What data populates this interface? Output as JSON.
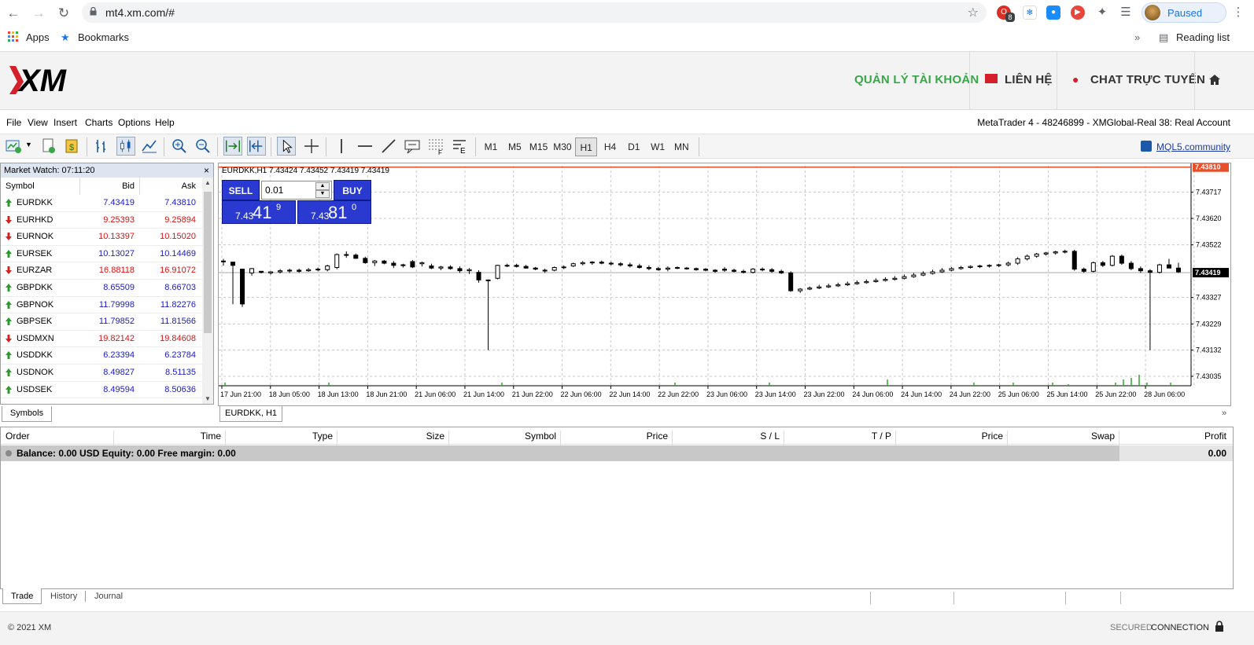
{
  "browser": {
    "url": "mt4.xm.com/#",
    "profile_status": "Paused",
    "bookmarks": {
      "apps": "Apps",
      "bookmarks": "Bookmarks",
      "reading_list": "Reading list"
    },
    "ext_badge": "8"
  },
  "xm_header": {
    "logo": "XM",
    "nav": {
      "account": "QUẢN LÝ TÀI KHOẢN",
      "contact": "LIÊN HỆ",
      "chat": "CHAT TRỰC TUYẾN"
    },
    "colors": {
      "account": "#3aa64a",
      "accent": "#d3202a"
    }
  },
  "menubar": {
    "items": [
      "File",
      "View",
      "Insert",
      "Charts",
      "Options",
      "Help"
    ],
    "account_info": "MetaTrader 4 - 48246899 - XMGlobal-Real 38: Real Account"
  },
  "toolbar": {
    "timeframes": [
      "M1",
      "M5",
      "M15",
      "M30",
      "H1",
      "H4",
      "D1",
      "W1",
      "MN"
    ],
    "active_timeframe": "H1",
    "mql5_link": "MQL5.community"
  },
  "market_watch": {
    "title": "Market Watch: 07:11:20",
    "columns": {
      "symbol": "Symbol",
      "bid": "Bid",
      "ask": "Ask"
    },
    "rows": [
      {
        "symbol": "EURDKK",
        "bid": "7.43419",
        "ask": "7.43810",
        "dir": "up",
        "color": "#1a1acc"
      },
      {
        "symbol": "EURHKD",
        "bid": "9.25393",
        "ask": "9.25894",
        "dir": "down",
        "color": "#e01010"
      },
      {
        "symbol": "EURNOK",
        "bid": "10.13397",
        "ask": "10.15020",
        "dir": "down",
        "color": "#e01010"
      },
      {
        "symbol": "EURSEK",
        "bid": "10.13027",
        "ask": "10.14469",
        "dir": "up",
        "color": "#1a1acc"
      },
      {
        "symbol": "EURZAR",
        "bid": "16.88118",
        "ask": "16.91072",
        "dir": "down",
        "color": "#e01010"
      },
      {
        "symbol": "GBPDKK",
        "bid": "8.65509",
        "ask": "8.66703",
        "dir": "up",
        "color": "#1a1acc"
      },
      {
        "symbol": "GBPNOK",
        "bid": "11.79998",
        "ask": "11.82276",
        "dir": "up",
        "color": "#1a1acc"
      },
      {
        "symbol": "GBPSEK",
        "bid": "11.79852",
        "ask": "11.81566",
        "dir": "up",
        "color": "#1a1acc"
      },
      {
        "symbol": "USDMXN",
        "bid": "19.82142",
        "ask": "19.84608",
        "dir": "down",
        "color": "#e01010"
      },
      {
        "symbol": "USDDKK",
        "bid": "6.23394",
        "ask": "6.23784",
        "dir": "up",
        "color": "#1a1acc"
      },
      {
        "symbol": "USDNOK",
        "bid": "8.49827",
        "ask": "8.51135",
        "dir": "up",
        "color": "#1a1acc"
      },
      {
        "symbol": "USDSEK",
        "bid": "8.49594",
        "ask": "8.50636",
        "dir": "up",
        "color": "#1a1acc"
      }
    ],
    "tab": "Symbols"
  },
  "chart": {
    "info": "EURDKK,H1  7.43424 7.43452 7.43419 7.43419",
    "tab": "EURDKK, H1",
    "sell_label": "SELL",
    "buy_label": "BUY",
    "lot": "0.01",
    "sell_price": {
      "prefix": "7.43",
      "big": "41",
      "sup": "9"
    },
    "buy_price": {
      "prefix": "7.43",
      "big": "81",
      "sup": "0"
    },
    "ask_tag": "7.43810",
    "bid_tag": "7.43419"
  },
  "chart_data": {
    "type": "candlestick",
    "symbol": "EURDKK",
    "timeframe": "H1",
    "y_ticks": [
      "7.43717",
      "7.43620",
      "7.43522",
      "7.43327",
      "7.43229",
      "7.43132",
      "7.43035"
    ],
    "ylim": [
      7.43,
      7.43815
    ],
    "x_ticks": [
      "17 Jun 21:00",
      "18 Jun 05:00",
      "18 Jun 13:00",
      "18 Jun 21:00",
      "21 Jun 06:00",
      "21 Jun 14:00",
      "21 Jun 22:00",
      "22 Jun 06:00",
      "22 Jun 14:00",
      "22 Jun 22:00",
      "23 Jun 06:00",
      "23 Jun 14:00",
      "23 Jun 22:00",
      "24 Jun 06:00",
      "24 Jun 14:00",
      "24 Jun 22:00",
      "25 Jun 06:00",
      "25 Jun 14:00",
      "25 Jun 22:00",
      "28 Jun 06:00"
    ],
    "ask": 7.4381,
    "bid": 7.43419,
    "candles": [
      [
        7.43462,
        7.4347,
        7.43445,
        7.4346
      ],
      [
        7.43458,
        7.43446,
        7.43302,
        7.43446
      ],
      [
        7.43432,
        7.43432,
        7.43292,
        7.43303
      ],
      [
        7.43418,
        7.43436,
        7.43408,
        7.43434
      ],
      [
        7.43424,
        7.43424,
        7.43416,
        7.4342
      ],
      [
        7.43418,
        7.43424,
        7.43412,
        7.43422
      ],
      [
        7.43422,
        7.43432,
        7.43416,
        7.43426
      ],
      [
        7.43426,
        7.43434,
        7.43418,
        7.43428
      ],
      [
        7.43428,
        7.43434,
        7.43418,
        7.43424
      ],
      [
        7.43426,
        7.43436,
        7.43422,
        7.4343
      ],
      [
        7.43432,
        7.43438,
        7.43424,
        7.4343
      ],
      [
        7.4343,
        7.43448,
        7.43424,
        7.43444
      ],
      [
        7.43438,
        7.4349,
        7.43432,
        7.43486
      ],
      [
        7.43486,
        7.43498,
        7.43474,
        7.43484
      ],
      [
        7.43484,
        7.4349,
        7.4347,
        7.43472
      ],
      [
        7.43472,
        7.43478,
        7.43452,
        7.43456
      ],
      [
        7.43456,
        7.43466,
        7.43444,
        7.43462
      ],
      [
        7.43462,
        7.43466,
        7.4345,
        7.43454
      ],
      [
        7.43454,
        7.43462,
        7.43436,
        7.43446
      ],
      [
        7.43446,
        7.43452,
        7.43438,
        7.43448
      ],
      [
        7.4346,
        7.43466,
        7.43436,
        7.4344
      ],
      [
        7.43452,
        7.4346,
        7.43442,
        7.43456
      ],
      [
        7.43444,
        7.43452,
        7.43432,
        7.43436
      ],
      [
        7.43436,
        7.43444,
        7.43428,
        7.4344
      ],
      [
        7.4344,
        7.43446,
        7.4343,
        7.43434
      ],
      [
        7.43434,
        7.43442,
        7.43418,
        7.43426
      ],
      [
        7.43426,
        7.43436,
        7.43414,
        7.4343
      ],
      [
        7.4342,
        7.43428,
        7.43382,
        7.43392
      ],
      [
        7.43392,
        7.4339,
        7.43132,
        7.43389
      ],
      [
        7.43398,
        7.43448,
        7.43394,
        7.43446
      ],
      [
        7.43446,
        7.43452,
        7.4344,
        7.43446
      ],
      [
        7.43446,
        7.43452,
        7.43438,
        7.43442
      ],
      [
        7.43442,
        7.43448,
        7.43434,
        7.43436
      ],
      [
        7.43436,
        7.4344,
        7.43428,
        7.43432
      ],
      [
        7.43426,
        7.43434,
        7.43418,
        7.43428
      ],
      [
        7.43428,
        7.43442,
        7.43424,
        7.43438
      ],
      [
        7.43438,
        7.43446,
        7.43432,
        7.4344
      ],
      [
        7.43444,
        7.43456,
        7.4344,
        7.43452
      ],
      [
        7.43452,
        7.43462,
        7.43446,
        7.43456
      ],
      [
        7.43456,
        7.43462,
        7.43448,
        7.43458
      ],
      [
        7.43458,
        7.43464,
        7.4345,
        7.43454
      ],
      [
        7.43454,
        7.4346,
        7.43446,
        7.43452
      ],
      [
        7.43452,
        7.43458,
        7.43442,
        7.43448
      ],
      [
        7.43448,
        7.43456,
        7.43438,
        7.43444
      ],
      [
        7.43444,
        7.43452,
        7.43434,
        7.43438
      ],
      [
        7.43438,
        7.43446,
        7.43428,
        7.43434
      ],
      [
        7.43434,
        7.4344,
        7.43426,
        7.4343
      ],
      [
        7.43432,
        7.43442,
        7.43424,
        7.43436
      ],
      [
        7.43438,
        7.43442,
        7.43432,
        7.43436
      ],
      [
        7.43436,
        7.4344,
        7.4343,
        7.43434
      ],
      [
        7.43434,
        7.43438,
        7.43426,
        7.4343
      ],
      [
        7.43432,
        7.43436,
        7.43424,
        7.43428
      ],
      [
        7.43428,
        7.43432,
        7.43418,
        7.43424
      ],
      [
        7.43432,
        7.4344,
        7.43422,
        7.43428
      ],
      [
        7.43428,
        7.43434,
        7.4342,
        7.43424
      ],
      [
        7.43424,
        7.4343,
        7.43416,
        7.4342
      ],
      [
        7.4342,
        7.43436,
        7.43416,
        7.43432
      ],
      [
        7.43432,
        7.43438,
        7.43424,
        7.4343
      ],
      [
        7.4343,
        7.43436,
        7.43418,
        7.43424
      ],
      [
        7.43424,
        7.4343,
        7.43414,
        7.43418
      ],
      [
        7.43418,
        7.43424,
        7.43348,
        7.43352
      ],
      [
        7.43352,
        7.43362,
        7.43344,
        7.43358
      ],
      [
        7.43358,
        7.43368,
        7.43354,
        7.43362
      ],
      [
        7.43362,
        7.43374,
        7.43358,
        7.43366
      ],
      [
        7.43366,
        7.43378,
        7.43362,
        7.4337
      ],
      [
        7.4337,
        7.43382,
        7.43366,
        7.43374
      ],
      [
        7.43374,
        7.43386,
        7.4337,
        7.43378
      ],
      [
        7.43378,
        7.4339,
        7.43374,
        7.43382
      ],
      [
        7.43382,
        7.43394,
        7.43378,
        7.43386
      ],
      [
        7.43386,
        7.43398,
        7.43382,
        7.4339
      ],
      [
        7.4339,
        7.43402,
        7.43386,
        7.43394
      ],
      [
        7.43394,
        7.43406,
        7.4339,
        7.43398
      ],
      [
        7.43398,
        7.43412,
        7.43394,
        7.43404
      ],
      [
        7.43404,
        7.43418,
        7.434,
        7.4341
      ],
      [
        7.4341,
        7.43424,
        7.43406,
        7.43416
      ],
      [
        7.43416,
        7.4343,
        7.43412,
        7.43422
      ],
      [
        7.43422,
        7.43436,
        7.43418,
        7.43428
      ],
      [
        7.43428,
        7.4344,
        7.43424,
        7.43434
      ],
      [
        7.43434,
        7.43444,
        7.4343,
        7.43438
      ],
      [
        7.43438,
        7.43446,
        7.43434,
        7.43442
      ],
      [
        7.43442,
        7.43448,
        7.43436,
        7.43444
      ],
      [
        7.43444,
        7.4345,
        7.43438,
        7.43446
      ],
      [
        7.43446,
        7.43452,
        7.4344,
        7.43448
      ],
      [
        7.43448,
        7.4346,
        7.43442,
        7.43454
      ],
      [
        7.43454,
        7.43476,
        7.43448,
        7.4347
      ],
      [
        7.4347,
        7.43486,
        7.43464,
        7.4348
      ],
      [
        7.4348,
        7.43492,
        7.43474,
        7.43488
      ],
      [
        7.43488,
        7.43496,
        7.43482,
        7.43492
      ],
      [
        7.43492,
        7.435,
        7.43486,
        7.43496
      ],
      [
        7.43496,
        7.43504,
        7.4349,
        7.43498
      ],
      [
        7.43498,
        7.43504,
        7.43426,
        7.43432
      ],
      [
        7.43432,
        7.43438,
        7.43418,
        7.43424
      ],
      [
        7.43424,
        7.4346,
        7.4342,
        7.43456
      ],
      [
        7.43456,
        7.43462,
        7.4344,
        7.43446
      ],
      [
        7.43446,
        7.43484,
        7.43442,
        7.4348
      ],
      [
        7.4348,
        7.43486,
        7.43448,
        7.43454
      ],
      [
        7.43454,
        7.43462,
        7.43428,
        7.43434
      ],
      [
        7.43434,
        7.43442,
        7.43418,
        7.43426
      ],
      [
        7.43426,
        7.43432,
        7.43132,
        7.4342
      ],
      [
        7.4342,
        7.43452,
        7.43416,
        7.43448
      ],
      [
        7.43448,
        7.4347,
        7.43442,
        7.43436
      ],
      [
        7.43436,
        7.43456,
        7.43418,
        7.43422
      ]
    ]
  },
  "trade": {
    "columns": [
      "Order",
      "Time",
      "Type",
      "Size",
      "Symbol",
      "Price",
      "S / L",
      "T / P",
      "Price",
      "Swap",
      "Profit"
    ],
    "balance_line": "Balance: 0.00 USD  Equity: 0.00  Free margin: 0.00",
    "profit_total": "0.00",
    "tabs": [
      "Trade",
      "History",
      "Journal"
    ]
  },
  "footer": {
    "copyright": "© 2021 XM",
    "secured": "SECURED",
    "connection": "CONNECTION"
  }
}
